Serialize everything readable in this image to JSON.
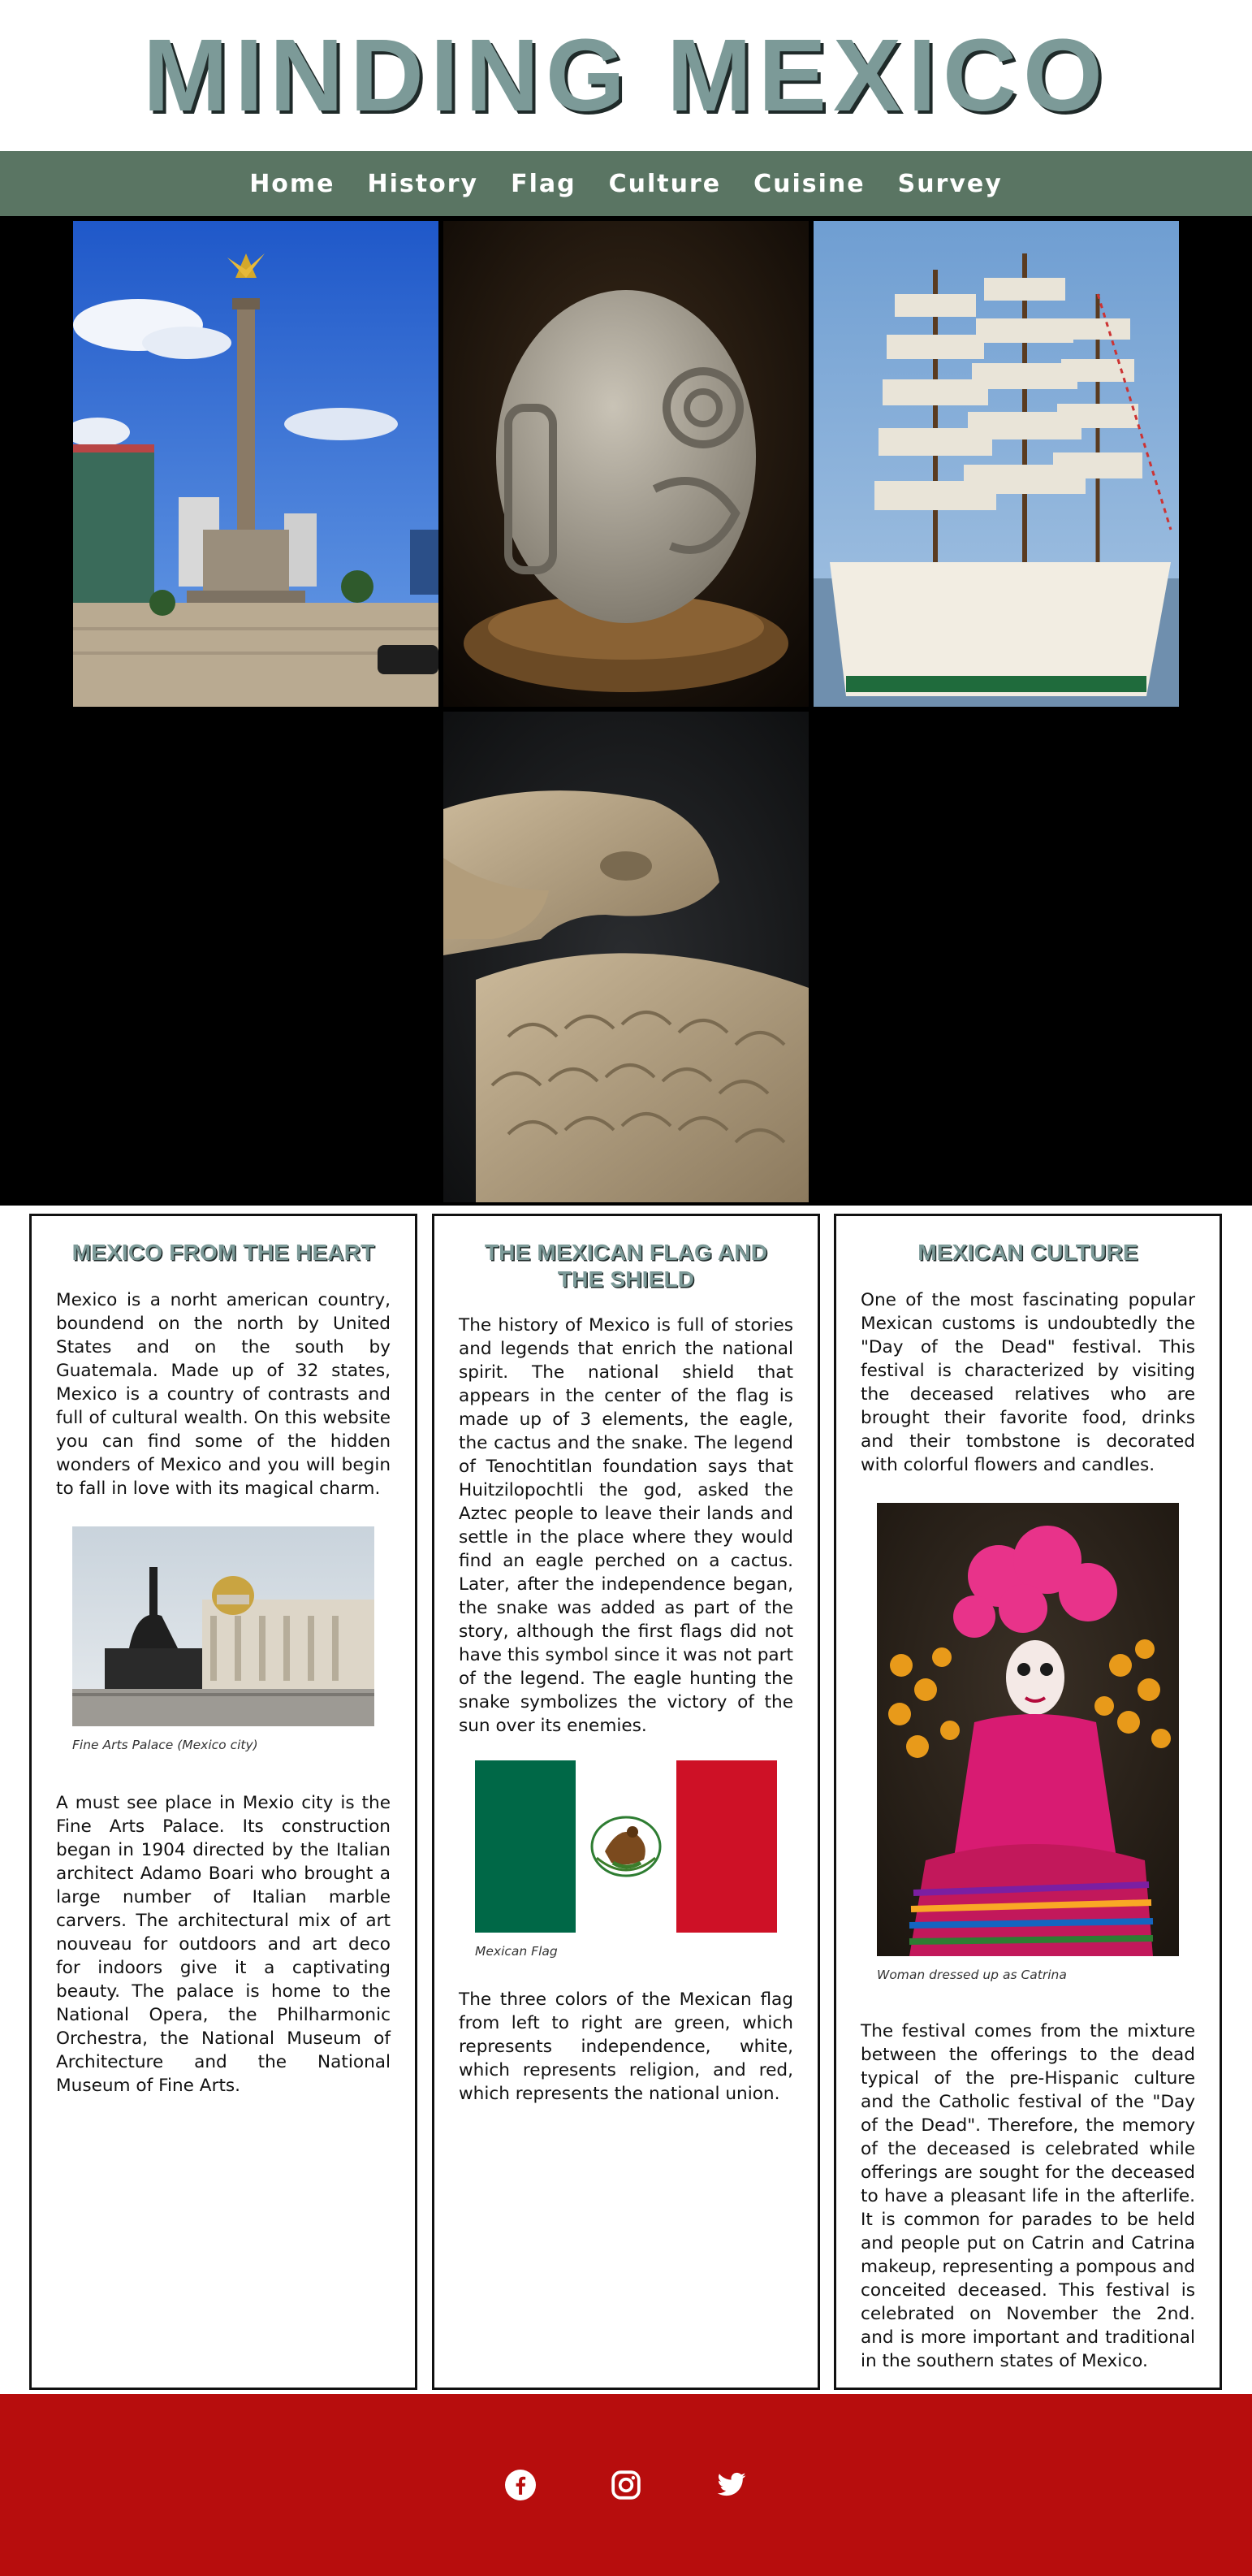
{
  "site": {
    "title": "MINDING MEXICO"
  },
  "nav": {
    "items": [
      "Home",
      "History",
      "Flag",
      "Culture",
      "Cuisine",
      "Survey"
    ]
  },
  "columns": {
    "heart": {
      "title": "MEXICO FROM THE HEART",
      "p1": "Mexico is a norht american country, boundend on the north by United States and on the south by Guatemala. Made up of 32 states, Mexico is a country of contrasts and full of cultural wealth. On this website you can find some of the hidden wonders of Mexico and you will begin to fall in love with its magical charm.",
      "caption": "Fine Arts Palace (Mexico city)",
      "p2": "A must see place in Mexio city is the Fine Arts Palace. Its construction began in 1904 directed by the Italian architect Adamo Boari who brought a large number of Italian marble carvers. The architectural mix of art nouveau for outdoors and art deco for indoors give it a captivating beauty. The palace is home to the National Opera, the Philharmonic Orchestra, the National Museum of Architecture and the National Museum of Fine Arts."
    },
    "flag": {
      "title": "THE MEXICAN FLAG AND THE SHIELD",
      "p1": "The history of Mexico is full of stories and legends that enrich the national spirit. The national shield that appears in the center of the flag is made up of 3 elements, the eagle, the cactus and the snake. The legend of Tenochtitlan foundation says that Huitzilopochtli the god, asked the Aztec people to leave their lands and settle in the place where they would find an eagle perched on a cactus. Later, after the independence began, the snake was added as part of the story, although the first flags did not have this symbol since it was not part of the legend. The eagle hunting the snake symbolizes the victory of the sun over its enemies.",
      "caption": "Mexican Flag",
      "p2": "The three colors of the Mexican flag from left to right are green, which represents independence, white, which represents religion, and red, which represents the national union."
    },
    "culture": {
      "title": "MEXICAN CULTURE",
      "p1": "One of the most fascinating popular Mexican customs is undoubtedly the \"Day of the Dead\" festival. This festival is characterized by visiting the deceased relatives who are brought their favorite food, drinks and their tombstone is decorated with colorful flowers and candles.",
      "caption": "Woman dressed up as Catrina",
      "p2": "The festival comes from the mixture between the offerings to the dead typical of the pre-Hispanic culture and the Catholic festival of the \"Day of the Dead\". Therefore, the memory of the deceased is celebrated while offerings are sought for the deceased to have a pleasant life in the afterlife. It is common for parades to be held and people put on Catrin and Catrina makeup, representing a pompous and conceited deceased. This festival is celebrated on November the 2nd. and is more important and traditional in the southern states of Mexico."
    }
  },
  "footer": {
    "icons": [
      "facebook-icon",
      "instagram-icon",
      "twitter-icon"
    ]
  },
  "colors": {
    "title": "#7c9a98",
    "nav_bg": "#5a7563",
    "gallery_bg": "#000000",
    "footer_bg": "#b70d0d",
    "flag_green": "#006847",
    "flag_red": "#ce1126"
  }
}
